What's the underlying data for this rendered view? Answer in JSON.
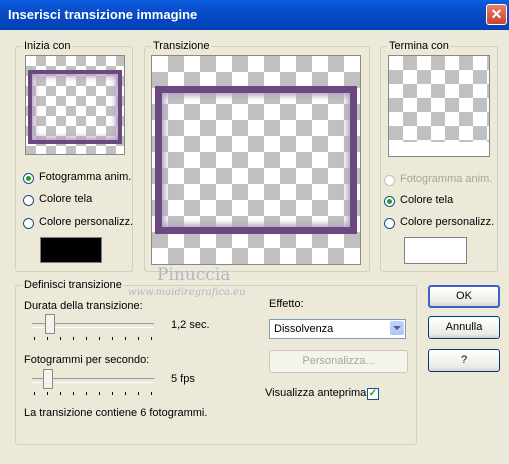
{
  "window": {
    "title": "Inserisci transizione immagine"
  },
  "start": {
    "legend": "Inizia con",
    "options": [
      "Fotogramma anim.",
      "Colore tela",
      "Colore personalizz."
    ],
    "selected_index": 0,
    "custom_color": "#000000"
  },
  "transition_preview": {
    "legend": "Transizione"
  },
  "end": {
    "legend": "Termina con",
    "options": [
      "Fotogramma anim.",
      "Colore tela",
      "Colore personalizz."
    ],
    "selected_index": 1,
    "custom_color": "#ffffff"
  },
  "define": {
    "legend": "Definisci transizione",
    "duration_label": "Durata della transizione:",
    "duration_value": "1,2 sec.",
    "fps_label": "Fotogrammi per secondo:",
    "fps_value": "5 fps",
    "info": "La transizione contiene 6 fotogrammi.",
    "effect_label": "Effetto:",
    "effect_value": "Dissolvenza",
    "customize_label": "Personalizza...",
    "preview_label": "Visualizza anteprima",
    "preview_checked": true
  },
  "buttons": {
    "ok": "OK",
    "cancel": "Annulla",
    "help": "?"
  },
  "watermark": {
    "name": "Pinuccia",
    "site": "www.maidiregrafica.eu"
  }
}
